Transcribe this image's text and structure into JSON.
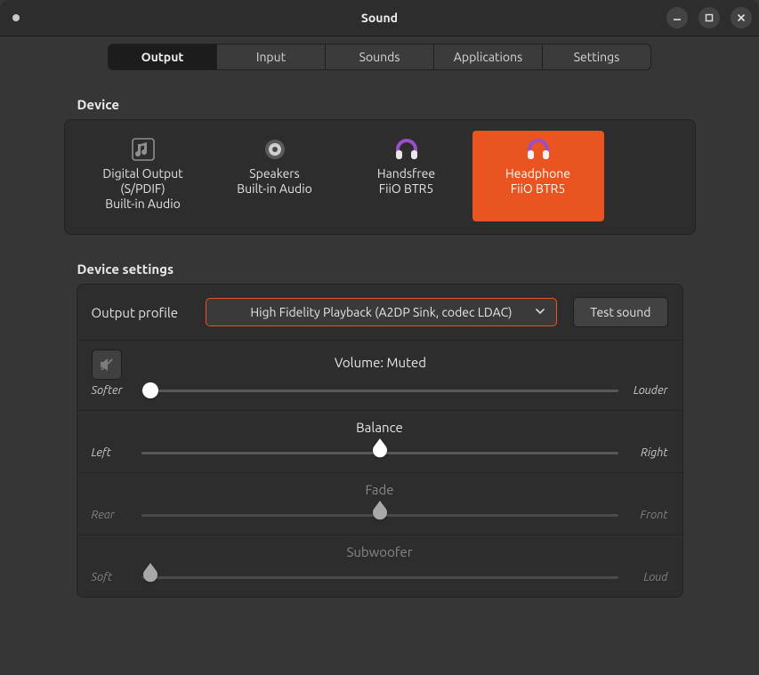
{
  "window": {
    "title": "Sound"
  },
  "tabs": [
    "Output",
    "Input",
    "Sounds",
    "Applications",
    "Settings"
  ],
  "active_tab": "Output",
  "section_device_label": "Device",
  "section_settings_label": "Device settings",
  "devices": [
    {
      "icon": "music-note",
      "title": "Digital Output (S/PDIF)",
      "sub": "Built-in Audio",
      "selected": false
    },
    {
      "icon": "speaker",
      "title": "Speakers",
      "sub": "Built-in Audio",
      "selected": false
    },
    {
      "icon": "headphones",
      "title": "Handsfree",
      "sub": "FiiO BTR5",
      "selected": false
    },
    {
      "icon": "headphones",
      "title": "Headphone",
      "sub": "FiiO BTR5",
      "selected": true
    }
  ],
  "profile": {
    "label": "Output profile",
    "value": "High Fidelity Playback (A2DP Sink, codec LDAC)",
    "test_label": "Test sound"
  },
  "sliders": {
    "volume": {
      "title": "Volume: Muted",
      "left": "Softer",
      "right": "Louder",
      "pos_pct": 2,
      "muted": true,
      "enabled": true
    },
    "balance": {
      "title": "Balance",
      "left": "Left",
      "right": "Right",
      "pos_pct": 50,
      "enabled": true
    },
    "fade": {
      "title": "Fade",
      "left": "Rear",
      "right": "Front",
      "pos_pct": 50,
      "enabled": false
    },
    "subwoofer": {
      "title": "Subwoofer",
      "left": "Soft",
      "right": "Loud",
      "pos_pct": 2,
      "enabled": false
    }
  },
  "colors": {
    "accent": "#e95420"
  }
}
